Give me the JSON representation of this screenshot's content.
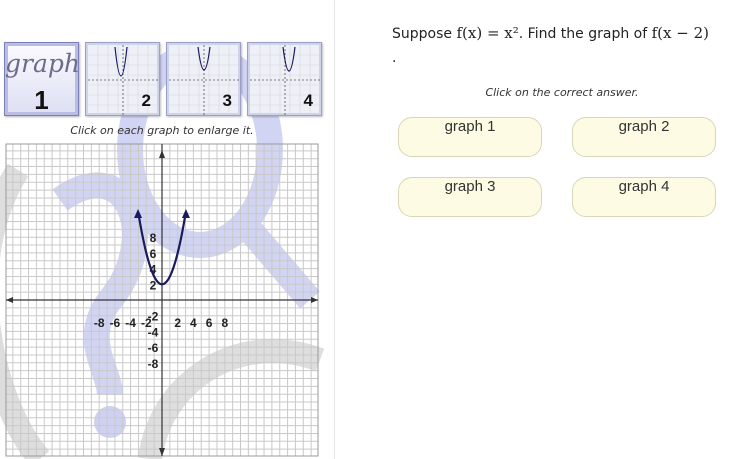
{
  "thumbnails": {
    "title_word": "graph",
    "items": [
      {
        "label": "1",
        "selected": true
      },
      {
        "label": "2",
        "selected": false
      },
      {
        "label": "3",
        "selected": false
      },
      {
        "label": "4",
        "selected": false
      }
    ]
  },
  "hint_text": "Click on each graph to enlarge it.",
  "graph": {
    "x_tick_labels": [
      "-8",
      "-6",
      "-4",
      "-2",
      "2",
      "4",
      "6",
      "8"
    ],
    "y_tick_labels": [
      "8",
      "6",
      "4",
      "2",
      "-2",
      "-4",
      "-6",
      "-8"
    ],
    "curve_color": "#1a1a5e",
    "watermark_color": "#b8bbee"
  },
  "question": {
    "prefix": "Suppose ",
    "given": "f(x) = x²",
    "middle": ". Find the graph of ",
    "target": "f(x − 2)",
    "end": "."
  },
  "instruction": "Click on the correct answer.",
  "answers": [
    "graph 1",
    "graph 2",
    "graph 3",
    "graph 4"
  ]
}
